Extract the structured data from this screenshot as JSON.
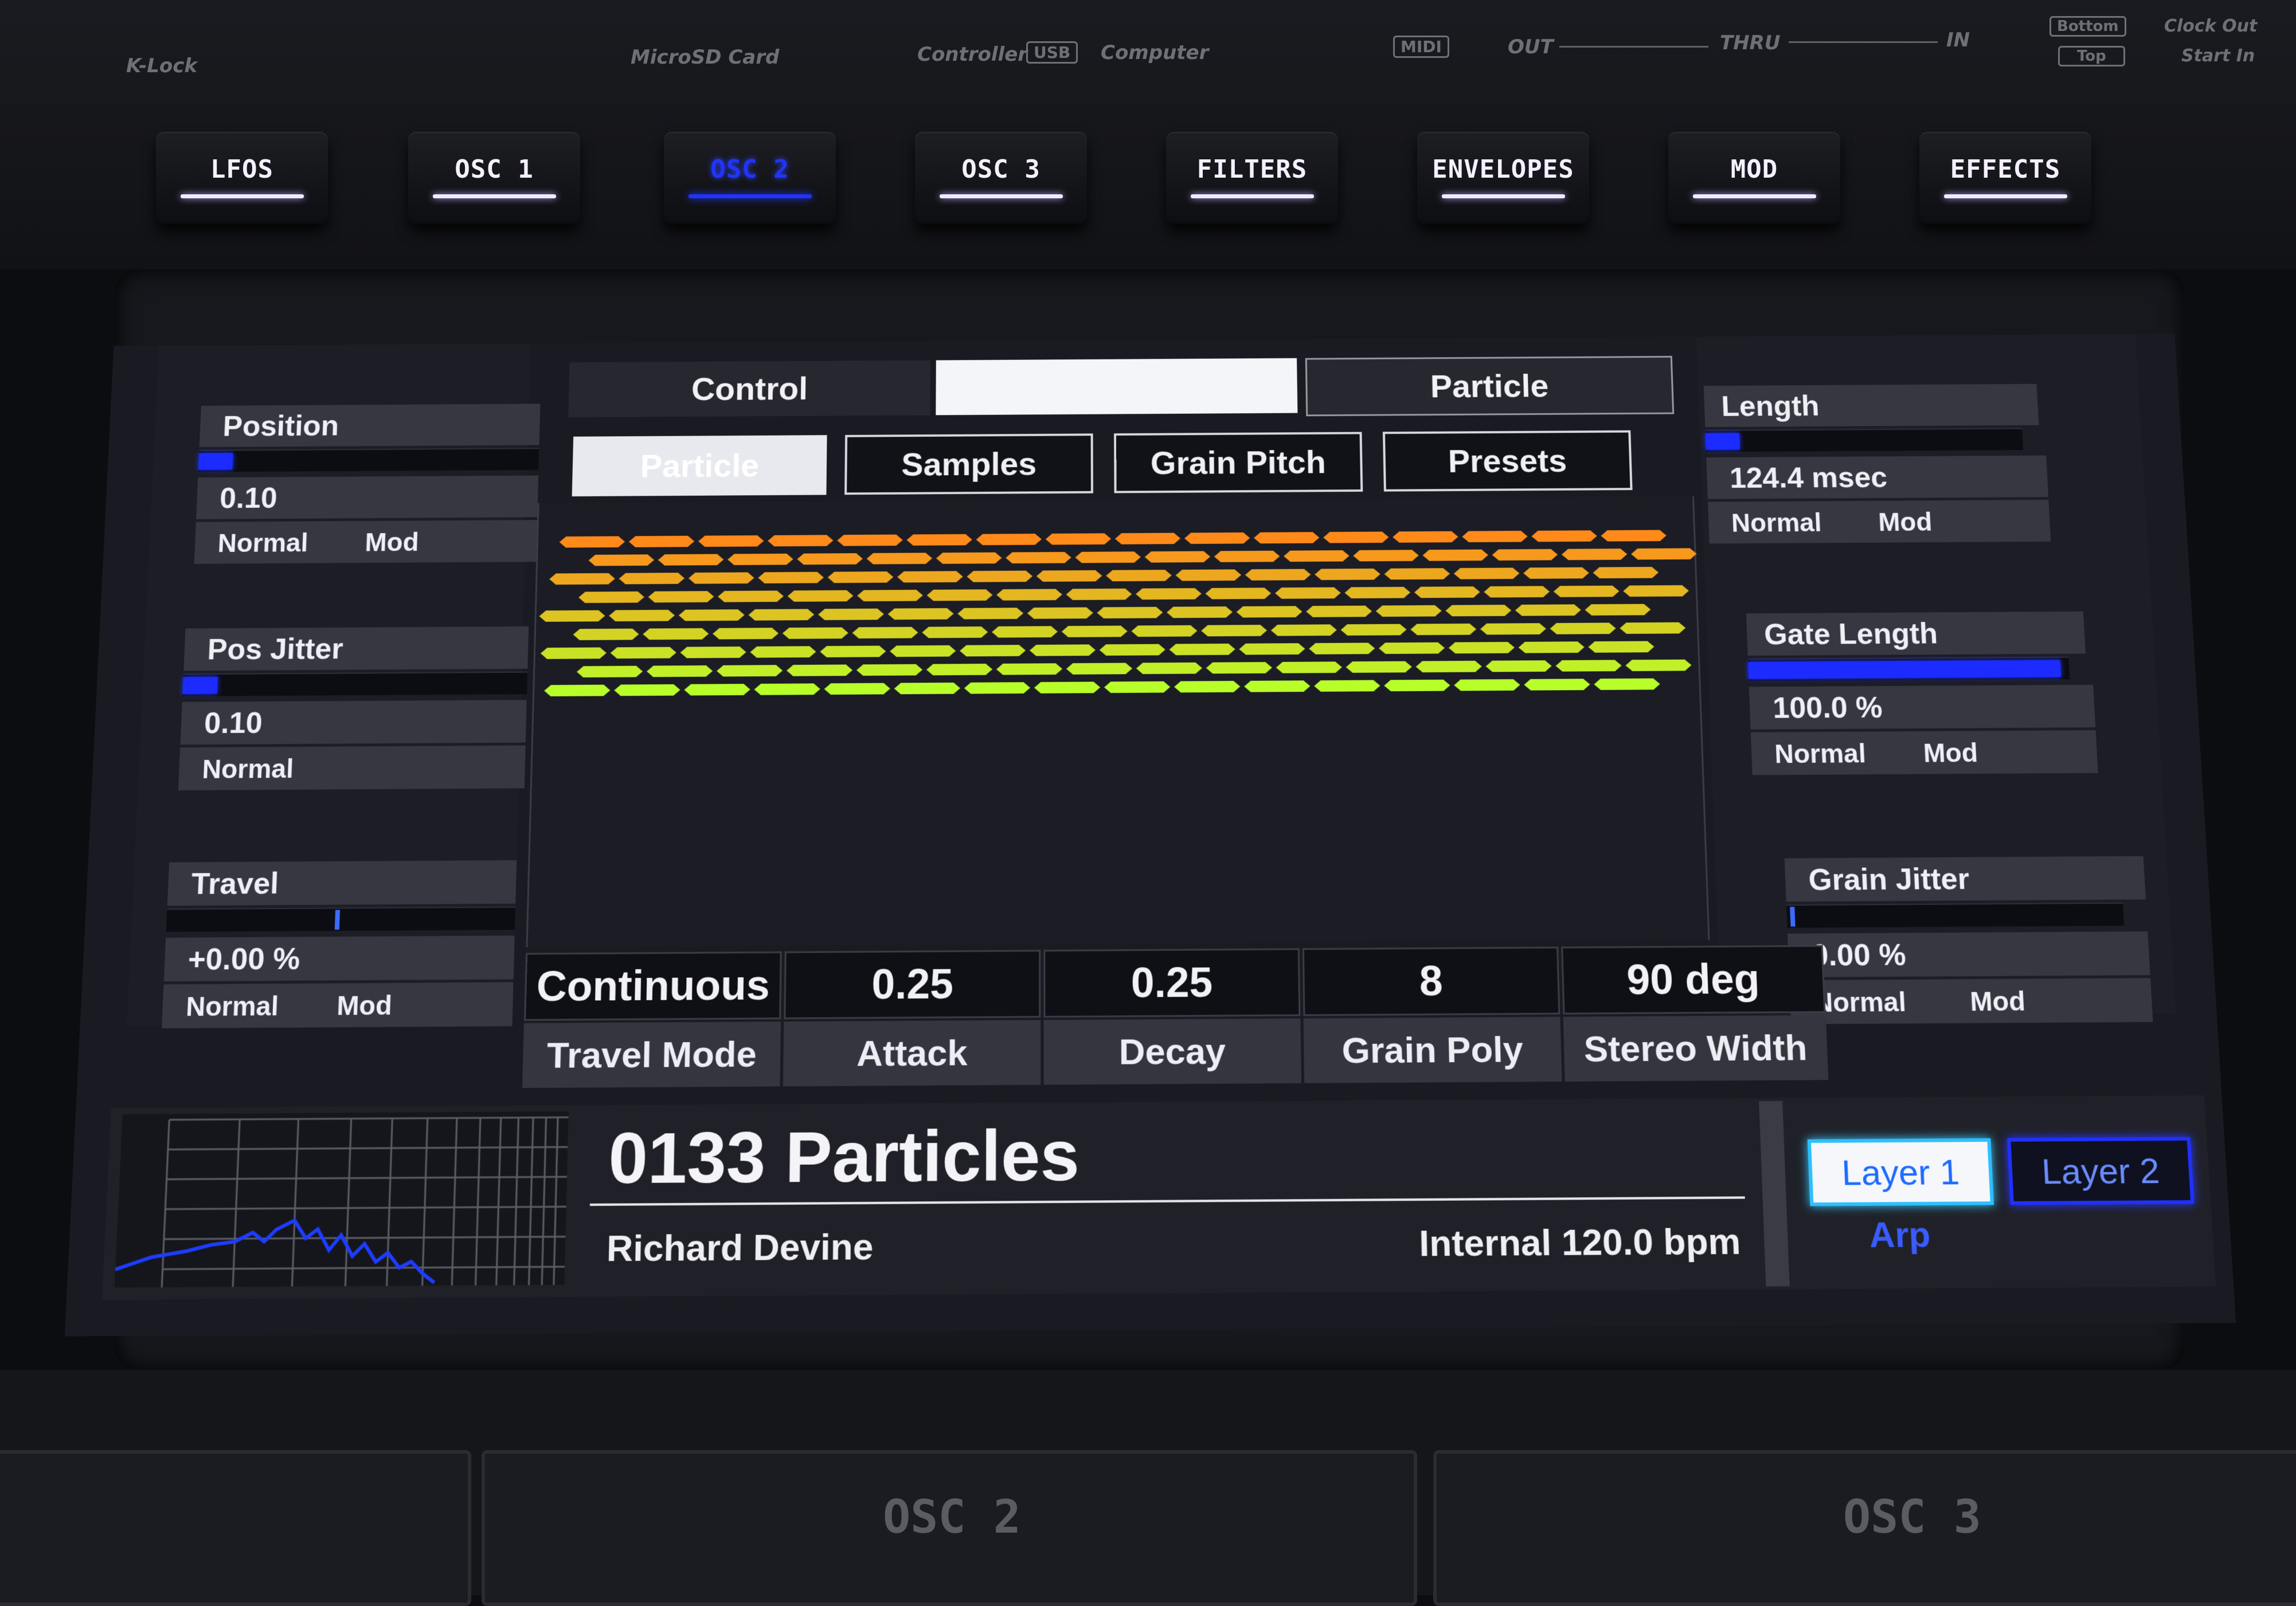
{
  "panel": {
    "k_lock": "K-Lock",
    "microsd": "MicroSD Card",
    "controller": "Controller",
    "usb": "USB",
    "computer": "Computer",
    "midi": "MIDI",
    "out": "OUT",
    "thru": "THRU",
    "in": "IN",
    "bottom": "Bottom",
    "top": "Top",
    "clock_out": "Clock Out",
    "start_in": "Start In"
  },
  "hw_buttons": [
    {
      "label": "LFOS",
      "active": false
    },
    {
      "label": "OSC 1",
      "active": false
    },
    {
      "label": "OSC 2",
      "active": true
    },
    {
      "label": "OSC 3",
      "active": false
    },
    {
      "label": "FILTERS",
      "active": false
    },
    {
      "label": "ENVELOPES",
      "active": false
    },
    {
      "label": "MOD",
      "active": false
    },
    {
      "label": "EFFECTS",
      "active": false
    }
  ],
  "screen": {
    "top_tabs": {
      "left": "Control",
      "middle": "",
      "right": "Particle"
    },
    "sub_tabs": [
      "Particle",
      "Samples",
      "Grain Pitch",
      "Presets"
    ],
    "left_params": [
      {
        "name": "Position",
        "value": "0.10",
        "normal": "Normal",
        "mod": "Mod",
        "level": 0.1
      },
      {
        "name": "Pos Jitter",
        "value": "0.10",
        "normal": "Normal",
        "mod": "",
        "level": 0.1
      },
      {
        "name": "Travel",
        "value": "+0.00 %",
        "normal": "Normal",
        "mod": "Mod",
        "level": 0.5
      }
    ],
    "right_params": [
      {
        "name": "Length",
        "value": "124.4 msec",
        "normal": "Normal",
        "mod": "Mod",
        "level": 0.1
      },
      {
        "name": "Gate Length",
        "value": "100.0 %",
        "normal": "Normal",
        "mod": "Mod",
        "level": 1.0
      },
      {
        "name": "Grain Jitter",
        "value": "0.00 %",
        "normal": "Normal",
        "mod": "Mod",
        "level": 0.0
      }
    ],
    "bottom_params": [
      {
        "value": "Continuous",
        "name": "Travel Mode"
      },
      {
        "value": "0.25",
        "name": "Attack"
      },
      {
        "value": "0.25",
        "name": "Decay"
      },
      {
        "value": "8",
        "name": "Grain Poly"
      },
      {
        "value": "90 deg",
        "name": "Stereo Width"
      }
    ],
    "preset": {
      "name": "0133 Particles",
      "author": "Richard Devine",
      "tempo": "Internal 120.0 bpm"
    },
    "layers": {
      "layer1": "Layer 1",
      "layer2": "Layer 2",
      "arp": "Arp"
    },
    "colors": {
      "accent": "#1c2bff",
      "grain_top": "#ff8a1a",
      "grain_bottom": "#b8ff2a"
    }
  },
  "lower_panel": {
    "left_label": "OSC 2",
    "right_label": "OSC 3"
  }
}
